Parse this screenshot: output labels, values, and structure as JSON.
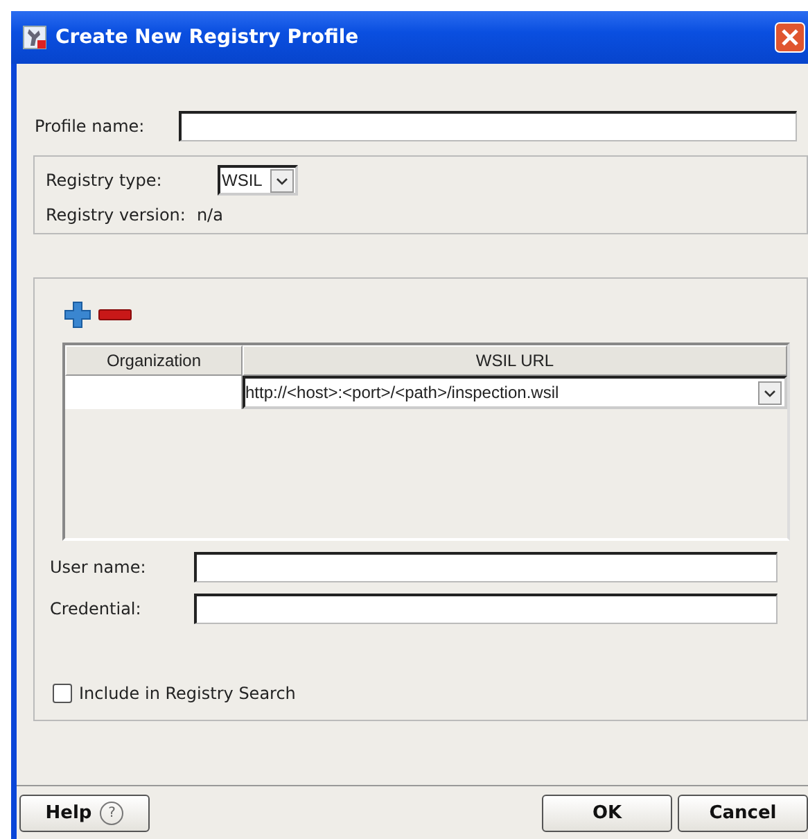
{
  "window": {
    "title": "Create New Registry Profile"
  },
  "profile_name": {
    "label": "Profile name:"
  },
  "registry": {
    "type_label": "Registry type:",
    "type_value": "WSIL",
    "version_label": "Registry version:",
    "version_value": "n/a"
  },
  "table": {
    "columns": [
      "Organization",
      "WSIL URL"
    ],
    "rows": [
      {
        "url": "http://<host>:<port>/<path>/inspection.wsil"
      }
    ]
  },
  "user_name": {
    "label": "User name:"
  },
  "credential": {
    "label": "Credential:"
  },
  "include_search": {
    "label": "Include in Registry Search",
    "checked": false
  },
  "buttons": {
    "help": "Help",
    "help_mark": "?",
    "ok": "OK",
    "cancel": "Cancel"
  }
}
